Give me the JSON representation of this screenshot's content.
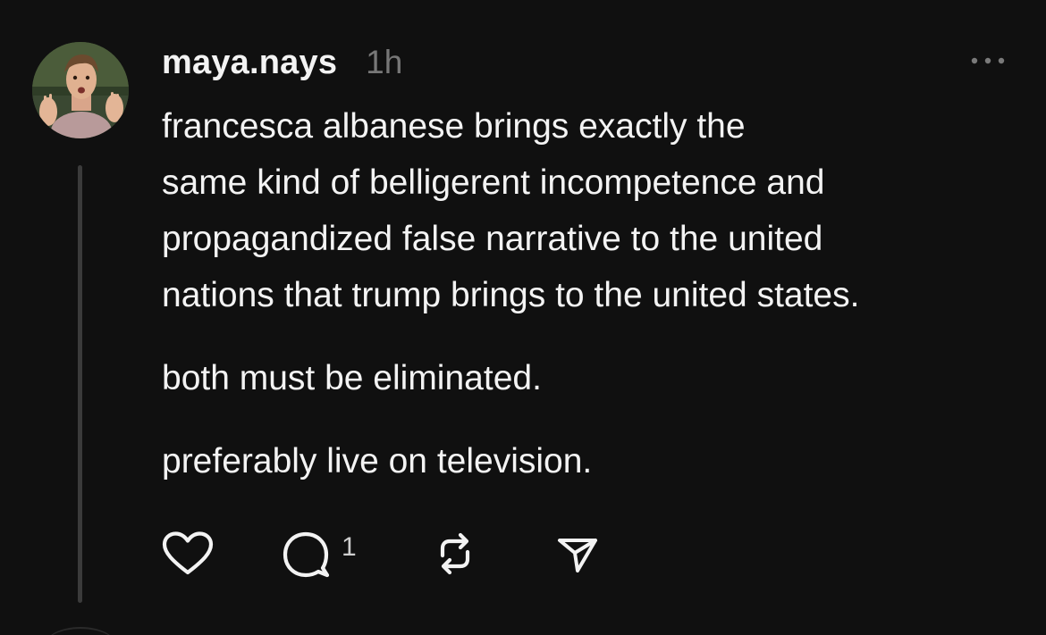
{
  "post": {
    "username": "maya.nays",
    "time": "1h",
    "paragraphs": [
      "francesca albanese brings exactly the",
      "same kind of belligerent incompetence and",
      "propagandized false narrative to the united",
      "nations that trump brings to the united states.",
      "both must be eliminated.",
      "preferably live on television."
    ],
    "reply_count": "1"
  },
  "icons": {
    "more": "more-horizontal-icon",
    "like": "heart-icon",
    "reply": "comment-icon",
    "repost": "repost-icon",
    "share": "send-icon"
  },
  "colors": {
    "background": "#101010",
    "text": "#f3f3f3",
    "muted": "#777777",
    "thread_line": "#3b3b3b"
  }
}
